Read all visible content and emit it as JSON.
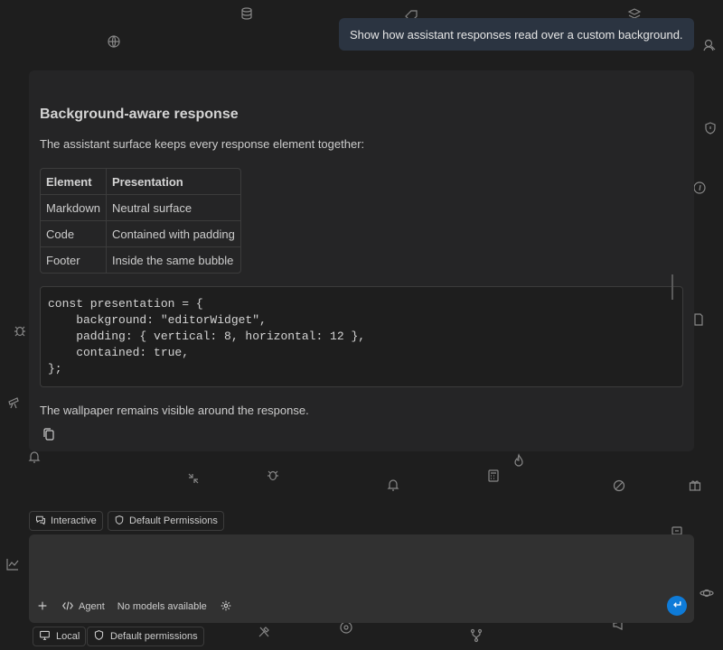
{
  "user_message": "Show how assistant responses read over a custom background.",
  "response": {
    "title": "Background-aware response",
    "intro": "The assistant surface keeps every response element together:",
    "table": {
      "headers": [
        "Element",
        "Presentation"
      ],
      "rows": [
        [
          "Markdown",
          "Neutral surface"
        ],
        [
          "Code",
          "Contained with padding"
        ],
        [
          "Footer",
          "Inside the same bubble"
        ]
      ]
    },
    "code_lines": [
      "const presentation = {",
      "    background: \"editorWidget\",",
      "    padding: { vertical: 8, horizontal: 12 },",
      "    contained: true,",
      "};"
    ],
    "outro": "The wallpaper remains visible around the response."
  },
  "chips": {
    "mode": "Interactive",
    "permissions": "Default Permissions"
  },
  "input": {
    "placeholder": "",
    "agent_label": "Agent",
    "model_label": "No models available"
  },
  "bottom": {
    "local_label": "Local",
    "permissions_label": "Default permissions"
  },
  "colors": {
    "background": "#1e1e1e",
    "user_bubble": "#2b3441",
    "response_surface": "#252526",
    "input_surface": "#313131",
    "send_button": "#0e7bd8"
  }
}
